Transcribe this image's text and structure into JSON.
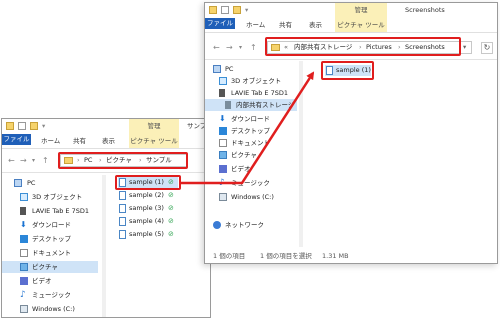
{
  "colors": {
    "accent_red": "#e01e1e",
    "file_tab": "#1f5fb8",
    "manage_tab": "#fbf0b8",
    "selection": "#cfe3f7"
  },
  "back_window": {
    "manage_label": "管理",
    "title": "サンプル",
    "ribbon": {
      "file": "ファイル",
      "home": "ホーム",
      "share": "共有",
      "view": "表示",
      "picture_tools": "ピクチャ ツール"
    },
    "address": {
      "parts": [
        "PC",
        "ピクチャ",
        "サンプル"
      ]
    },
    "nav": [
      {
        "label": "PC",
        "icon": "pc-icon"
      },
      {
        "label": "3D オブジェクト",
        "icon": "3d-objects-icon"
      },
      {
        "label": "LAVIE Tab E 7SD1",
        "icon": "tablet-icon"
      },
      {
        "label": "ダウンロード",
        "icon": "download-icon"
      },
      {
        "label": "デスクトップ",
        "icon": "desktop-icon"
      },
      {
        "label": "ドキュメント",
        "icon": "documents-icon"
      },
      {
        "label": "ピクチャ",
        "icon": "pictures-icon"
      },
      {
        "label": "ビデオ",
        "icon": "videos-icon"
      },
      {
        "label": "ミュージック",
        "icon": "music-icon"
      },
      {
        "label": "Windows (C:)",
        "icon": "drive-icon"
      }
    ],
    "files": [
      "sample (1)",
      "sample (2)",
      "sample (3)",
      "sample (4)",
      "sample (5)"
    ]
  },
  "front_window": {
    "manage_label": "管理",
    "title": "Screenshots",
    "ribbon": {
      "file": "ファイル",
      "home": "ホーム",
      "share": "共有",
      "view": "表示",
      "picture_tools": "ピクチャ ツール"
    },
    "address": {
      "prefix": "«",
      "parts": [
        "内部共有ストレージ",
        "Pictures",
        "Screenshots"
      ]
    },
    "nav": [
      {
        "label": "PC",
        "icon": "pc-icon"
      },
      {
        "label": "3D オブジェクト",
        "icon": "3d-objects-icon"
      },
      {
        "label": "LAVIE Tab E 7SD1",
        "icon": "tablet-icon"
      },
      {
        "label": "内部共有ストレージ",
        "icon": "storage-icon"
      },
      {
        "label": "ダウンロード",
        "icon": "download-icon"
      },
      {
        "label": "デスクトップ",
        "icon": "desktop-icon"
      },
      {
        "label": "ドキュメント",
        "icon": "documents-icon"
      },
      {
        "label": "ピクチャ",
        "icon": "pictures-icon"
      },
      {
        "label": "ビデオ",
        "icon": "videos-icon"
      },
      {
        "label": "ミュージック",
        "icon": "music-icon"
      },
      {
        "label": "Windows (C:)",
        "icon": "drive-icon"
      },
      {
        "label": "ネットワーク",
        "icon": "network-icon"
      }
    ],
    "files": [
      "sample (1)"
    ],
    "status": {
      "count": "1 個の項目",
      "selected": "1 個の項目を選択",
      "size": "1.31 MB"
    }
  }
}
